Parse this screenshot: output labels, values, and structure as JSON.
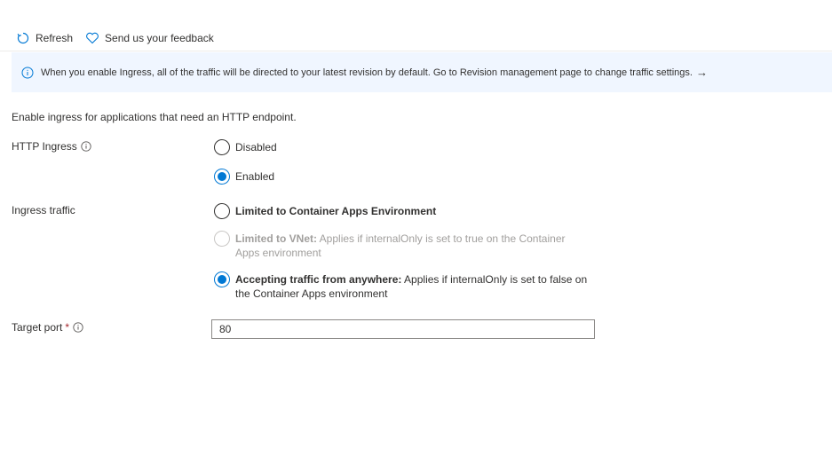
{
  "toolbar": {
    "refresh_label": "Refresh",
    "feedback_label": "Send us your feedback"
  },
  "info": {
    "message": "When you enable Ingress, all of the traffic will be directed to your latest revision by default. Go to Revision management page to change traffic settings.",
    "arrow": "→"
  },
  "description": "Enable ingress for applications that need an HTTP endpoint.",
  "http_ingress": {
    "label": "HTTP Ingress",
    "options": [
      {
        "label": "Disabled",
        "checked": false
      },
      {
        "label": "Enabled",
        "checked": true
      }
    ]
  },
  "ingress_traffic": {
    "label": "Ingress traffic",
    "options": [
      {
        "title": "Limited to Container Apps Environment",
        "detail": "",
        "checked": false,
        "disabled": false
      },
      {
        "title": "Limited to VNet:",
        "detail": " Applies if internalOnly is set to true on the Container Apps environment",
        "checked": false,
        "disabled": true
      },
      {
        "title": "Accepting traffic from anywhere:",
        "detail": " Applies if internalOnly is set to false on the Container Apps environment",
        "checked": true,
        "disabled": false
      }
    ]
  },
  "target_port": {
    "label": "Target port",
    "required_mark": "*",
    "value": "80"
  },
  "colors": {
    "accent": "#0078d4",
    "info_background": "#f0f6ff",
    "required": "#a4262c"
  }
}
